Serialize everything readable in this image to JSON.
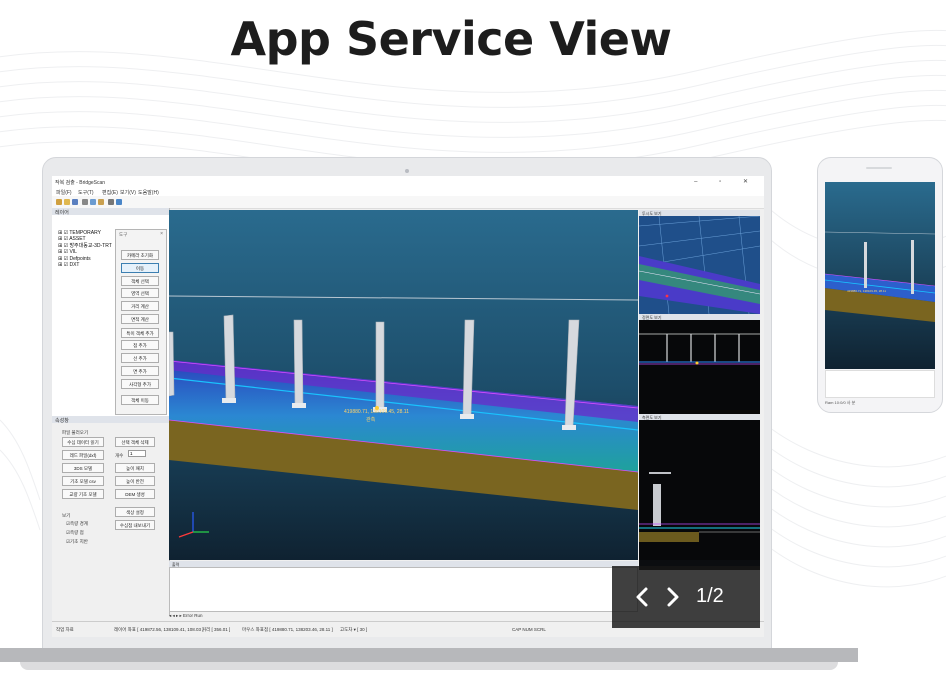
{
  "headline": "App Service View",
  "carousel": {
    "counter": "1/2",
    "prev_icon": "chevron-left-icon",
    "next_icon": "chevron-right-icon",
    "background": "#1a1a1a"
  },
  "app": {
    "title": "작복 검출 - BridgeScan",
    "window_buttons": "– ▫ ✕",
    "menu": [
      "파일(F)",
      "도구(T)",
      "편집(E)",
      "보기(V)",
      "도움말(H)"
    ],
    "layers_panel_title": "레이어",
    "tree": [
      "TEMPORARY",
      "ASSET",
      "방주대동교-3D-TRT",
      "VIL",
      "Defpoints",
      "DXT"
    ],
    "tool_popup": {
      "title": "도구",
      "buttons": [
        "카메라 초기화",
        "이동",
        "객체 선택",
        "영역 선택",
        "거리 계산",
        "면적 계산",
        "특이 객체 추가",
        "점 추가",
        "선 추가",
        "면 추가",
        "사각형 추가",
        "객체 이동"
      ]
    },
    "property_panel_title": "속성창",
    "file_group_label": "파일 불러오기",
    "file_buttons": [
      "수심 데이터 읽기",
      "레드 파일(dxf)",
      "3DS 모델",
      "기초 모델 csv",
      "교량 기초 모델"
    ],
    "right_buttons": [
      "선택 객체 삭제",
      "높이 패치",
      "높이 반전",
      "DEM 생성",
      "색상 설정",
      "수심점 내보내기"
    ],
    "count_label": "개수",
    "count_value": "1",
    "view_group_label": "보기",
    "view_checks": [
      "측량 경계",
      "측량 점",
      "기초 지반"
    ],
    "view_check_glyphs": [
      "☑",
      "☑",
      "☑"
    ],
    "viewport_label_coord": "419880.71, 138109.45, 28.11",
    "viewport_label_name": "관측",
    "right_view_titles": [
      "투시도 보기",
      "정면도 보기",
      "측면도 보기"
    ],
    "output_title": "출력",
    "tabs": "◂ ◂ ▸ ▸ Error Run",
    "status": {
      "left": "작업 자료",
      "mid1": "레이어 좌표 [ 419872.56, 138109.41, 108.03 ]",
      "mid2": "거리 [ 356.01 ]",
      "mid3": "마우스 좌표점 [ 419880.71, 138203.46, 28.11 ]",
      "mid4": "고도차 ▾ [ 30 ]",
      "right": "CAP  NUM  SCRL"
    }
  },
  "phone": {
    "label_coord": "419880.71, 138109.45, 28.11",
    "status": "Ram   10:0/0 사 분"
  }
}
